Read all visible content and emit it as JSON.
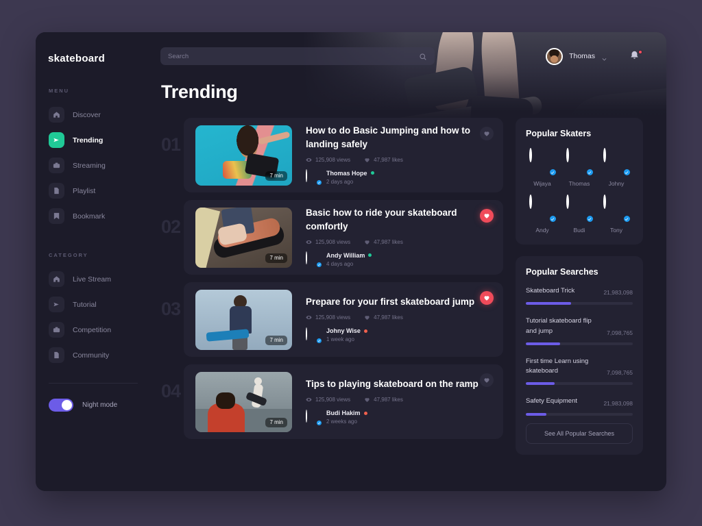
{
  "brand": "skateboard",
  "search": {
    "placeholder": "Search",
    "value": "",
    "icon": "search-icon"
  },
  "header": {
    "user_name": "Thomas",
    "chevron_icon": "chevron-down-icon",
    "bell_icon": "bell-icon",
    "notification_dot": true
  },
  "page_title": "Trending",
  "sidebar": {
    "menu_label": "MENU",
    "category_label": "CATEGORY",
    "menu_items": [
      {
        "label": "Discover",
        "icon": "home-icon",
        "active": false
      },
      {
        "label": "Trending",
        "icon": "send-icon",
        "active": true
      },
      {
        "label": "Streaming",
        "icon": "camera-icon",
        "active": false
      },
      {
        "label": "Playlist",
        "icon": "file-icon",
        "active": false
      },
      {
        "label": "Bookmark",
        "icon": "bookmark-icon",
        "active": false
      }
    ],
    "category_items": [
      {
        "label": "Live Stream",
        "icon": "home-icon",
        "active": false
      },
      {
        "label": "Tutorial",
        "icon": "send-icon",
        "active": false
      },
      {
        "label": "Competition",
        "icon": "camera-icon",
        "active": false
      },
      {
        "label": "Community",
        "icon": "file-icon",
        "active": false
      }
    ],
    "night_mode_label": "Night mode",
    "night_mode_on": true
  },
  "videos": [
    {
      "rank": "01",
      "title": "How to do Basic Jumping and how to landing safely",
      "duration": "7 min",
      "views": "125,908 views",
      "likes": "47,987 likes",
      "author": "Thomas Hope",
      "time": "2 days ago",
      "status_color": "#20c997",
      "liked": false,
      "thumb_colors": [
        "#25b6cf",
        "#1fa5c2"
      ]
    },
    {
      "rank": "02",
      "title": "Basic how to ride your skateboard comfortly",
      "duration": "7 min",
      "views": "125,908 views",
      "likes": "47,987 likes",
      "author": "Andy William",
      "time": "4 days ago",
      "status_color": "#20c997",
      "liked": true,
      "thumb_colors": [
        "#6f6158",
        "#4a4038"
      ]
    },
    {
      "rank": "03",
      "title": "Prepare for your first skateboard jump",
      "duration": "7 min",
      "views": "125,908 views",
      "likes": "47,987 likes",
      "author": "Johny Wise",
      "time": "1 week ago",
      "status_color": "#f0604d",
      "liked": true,
      "thumb_colors": [
        "#a9bccb",
        "#8fa6b8"
      ]
    },
    {
      "rank": "04",
      "title": "Tips to playing skateboard on the ramp",
      "duration": "7 min",
      "views": "125,908 views",
      "likes": "47,987 likes",
      "author": "Budi Hakim",
      "time": "2 weeks ago",
      "status_color": "#f0604d",
      "liked": false,
      "thumb_colors": [
        "#8e9ba0",
        "#6d7a80"
      ]
    }
  ],
  "popular_skaters": {
    "title": "Popular Skaters",
    "items": [
      {
        "name": "Wijaya",
        "bg": "#cbbfb4",
        "skin": "#a6745a",
        "hair": "#2d2119"
      },
      {
        "name": "Thomas",
        "bg": "#e7ddc5",
        "skin": "#c9946d",
        "hair": "#b7935a"
      },
      {
        "name": "Johny",
        "bg": "#b8c7d2",
        "skin": "#6d5e57",
        "hair": "#232a33"
      },
      {
        "name": "Andy",
        "bg": "#c9a277",
        "skin": "#b07a58",
        "hair": "#2a1d16"
      },
      {
        "name": "Budi",
        "bg": "#dfe7ea",
        "skin": "#b07f5c",
        "hair": "#7a3a24"
      },
      {
        "name": "Tony",
        "bg": "#8d4f32",
        "skin": "#a9714c",
        "hair": "#241610"
      }
    ]
  },
  "popular_searches": {
    "title": "Popular Searches",
    "items": [
      {
        "name": "Skateboard Trick",
        "count": "21,983,098",
        "percent": 42
      },
      {
        "name": "Tutorial skateboard flip and jump",
        "count": "7,098,765",
        "percent": 32
      },
      {
        "name": "First time Learn using skateboard",
        "count": "7,098,765",
        "percent": 27
      },
      {
        "name": "Safety Equipment",
        "count": "21,983,098",
        "percent": 19
      }
    ],
    "see_all_label": "See All Popular Searches"
  },
  "colors": {
    "accent_green": "#20c997",
    "accent_purple": "#6c5ce7",
    "accent_red": "#f04b5a",
    "verified_blue": "#1d9bf0",
    "window_bg": "#1c1b29",
    "panel_bg": "#232232",
    "page_bg": "#3d3850"
  }
}
